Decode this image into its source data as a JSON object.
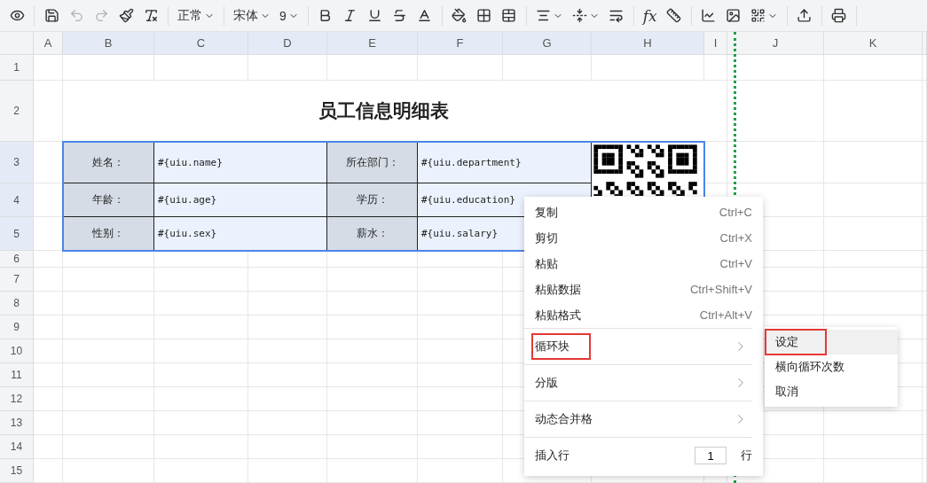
{
  "toolbar": {
    "undo": {
      "disabled": true
    },
    "redo": {
      "disabled": true
    },
    "style": "正常",
    "font": "宋体",
    "size": "9",
    "formula": "fx"
  },
  "columns": [
    {
      "label": "A",
      "selected": false
    },
    {
      "label": "B",
      "selected": true
    },
    {
      "label": "C",
      "selected": true
    },
    {
      "label": "D",
      "selected": true
    },
    {
      "label": "E",
      "selected": true
    },
    {
      "label": "F",
      "selected": true
    },
    {
      "label": "G",
      "selected": true
    },
    {
      "label": "H",
      "selected": true
    },
    {
      "label": "I",
      "selected": false
    },
    {
      "label": "J",
      "selected": false
    },
    {
      "label": "K",
      "selected": false
    }
  ],
  "rows": [
    {
      "label": "1",
      "selected": false
    },
    {
      "label": "2",
      "selected": false
    },
    {
      "label": "3",
      "selected": true
    },
    {
      "label": "4",
      "selected": true
    },
    {
      "label": "5",
      "selected": true
    },
    {
      "label": "6",
      "selected": false
    },
    {
      "label": "7",
      "selected": false
    },
    {
      "label": "8",
      "selected": false
    },
    {
      "label": "9",
      "selected": false
    },
    {
      "label": "10",
      "selected": false
    },
    {
      "label": "11",
      "selected": false
    },
    {
      "label": "12",
      "selected": false
    },
    {
      "label": "13",
      "selected": false
    },
    {
      "label": "14",
      "selected": false
    },
    {
      "label": "15",
      "selected": false
    }
  ],
  "title": "员工信息明细表",
  "table": [
    {
      "label": "姓名：",
      "value": "#{uiu.name}",
      "label2": "所在部门：",
      "value2": "#{uiu.department}"
    },
    {
      "label": "年龄：",
      "value": "#{uiu.age}",
      "label2": "学历：",
      "value2": "#{uiu.education}"
    },
    {
      "label": "性别：",
      "value": "#{uiu.sex}",
      "label2": "薪水：",
      "value2": "#{uiu.salary}"
    }
  ],
  "context_menu": [
    {
      "kind": "command",
      "label": "复制",
      "shortcut": "Ctrl+C"
    },
    {
      "kind": "command",
      "label": "剪切",
      "shortcut": "Ctrl+X"
    },
    {
      "kind": "command",
      "label": "粘贴",
      "shortcut": "Ctrl+V"
    },
    {
      "kind": "command",
      "label": "粘贴数据",
      "shortcut": "Ctrl+Shift+V"
    },
    {
      "kind": "command",
      "label": "粘贴格式",
      "shortcut": "Ctrl+Alt+V"
    },
    {
      "kind": "separator"
    },
    {
      "kind": "submenu",
      "label": "循环块",
      "highlighted": true,
      "children": [
        {
          "label": "设定",
          "selected": true,
          "highlighted": true
        },
        {
          "label": "横向循环次数",
          "selected": false,
          "highlighted": false
        },
        {
          "label": "取消",
          "selected": false,
          "highlighted": false
        }
      ]
    },
    {
      "kind": "separator"
    },
    {
      "kind": "submenu",
      "label": "分版",
      "highlighted": false
    },
    {
      "kind": "separator"
    },
    {
      "kind": "submenu",
      "label": "动态合并格",
      "highlighted": false
    },
    {
      "kind": "separator"
    },
    {
      "kind": "input",
      "label": "插入行",
      "value": "1",
      "unit": "行"
    }
  ]
}
